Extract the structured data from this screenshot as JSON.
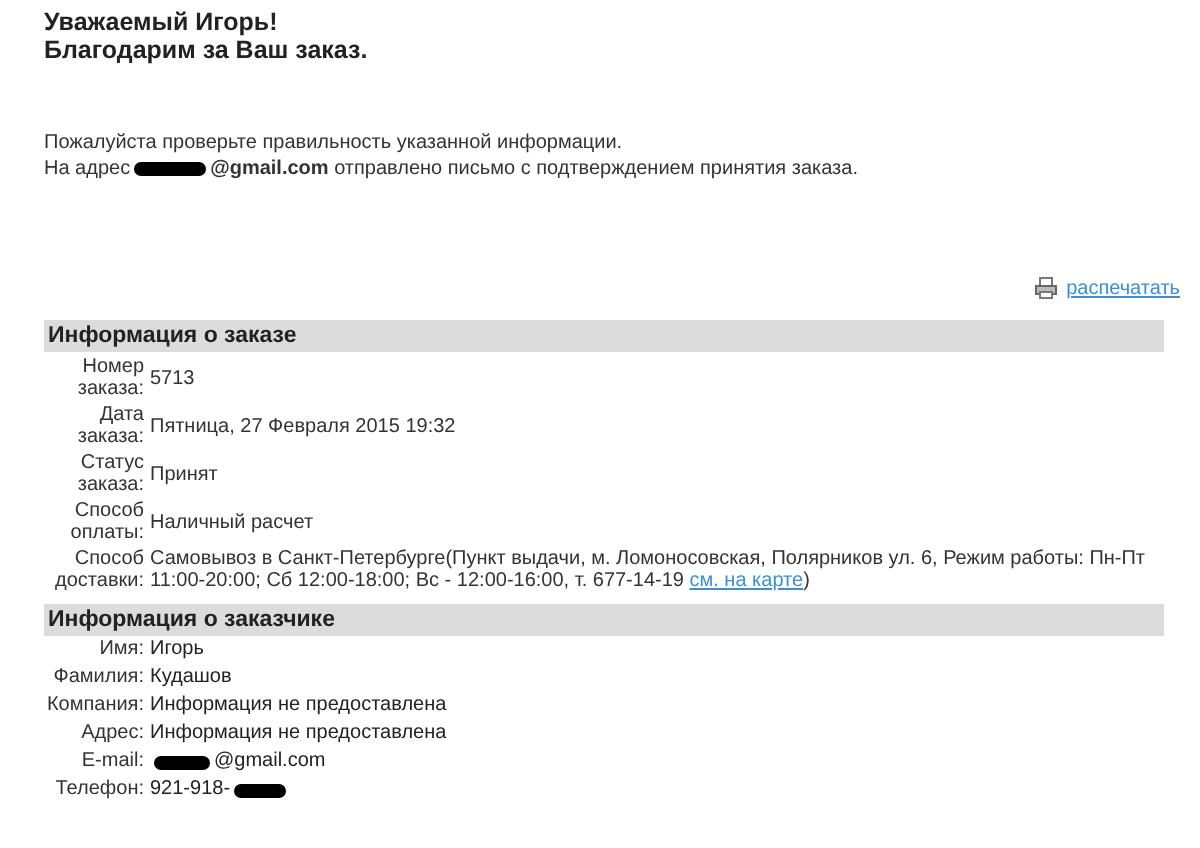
{
  "greeting": {
    "line_1": "Уважаемый Игорь!",
    "line_2": "Благодарим за Ваш заказ."
  },
  "notice": {
    "line_1": "Пожалуйста проверьте правильность указанной информации.",
    "line_2_prefix": "На адрес",
    "line_2_redacted": true,
    "line_2_rest": "**@gmail.com** отправлено письмо с подтверждением принятия заказа."
  },
  "print_link": "распечатать",
  "order_info": {
    "title": "Информация о заказе",
    "rows": [
      {
        "label": "Номер заказа:",
        "value": "5713"
      },
      {
        "label": "Дата заказа:",
        "value": "Пятница, 27 Февраля 2015 19:32"
      },
      {
        "label": "Статус заказа:",
        "value": "Принят"
      },
      {
        "label": "Способ оплаты:",
        "value": "Наличный расчет"
      },
      {
        "label": "Способ доставки:",
        "value": "Самовывоз в Санкт-Петербурге(Пункт выдачи, м. Ломоносовская, Полярников ул. 6, Режим работы: Пн-Пт 11:00-20:00; Сб 12:00-18:00; Вс - 12:00-16:00, т. 677-14-19",
        "link": "см. на карте",
        "suffix": ")"
      }
    ]
  },
  "customer_info": {
    "title": "Информация о заказчике",
    "rows": [
      {
        "label": "Имя:",
        "value": "Игорь",
        "redacted_before": false,
        "redacted_after": false
      },
      {
        "label": "Фамилия:",
        "value": "Кудашов",
        "redacted_before": false,
        "redacted_after": false
      },
      {
        "label": "Компания:",
        "value": "Информация не предоставлена",
        "redacted_before": false,
        "redacted_after": false
      },
      {
        "label": "Адрес:",
        "value": "Информация не предоставлена",
        "redacted_before": false,
        "redacted_after": false
      },
      {
        "label": "E-mail:",
        "value": "@gmail.com",
        "redacted_before": true,
        "redacted_after": false
      },
      {
        "label": "Телефон:",
        "value": "921-918-",
        "redacted_before": false,
        "redacted_after": true
      }
    ]
  }
}
